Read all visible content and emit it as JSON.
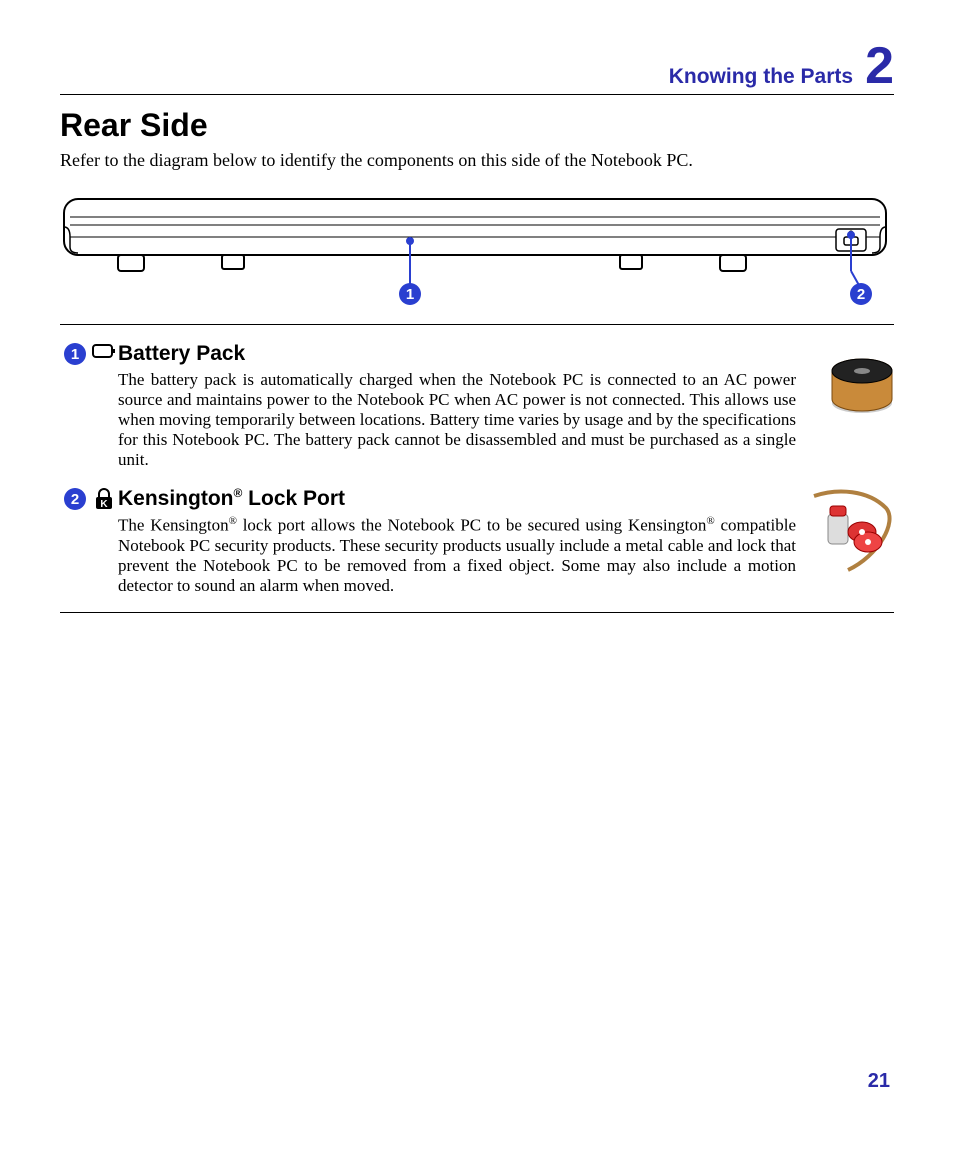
{
  "header": {
    "title": "Knowing the Parts",
    "chapter_number": "2"
  },
  "section": {
    "title": "Rear Side",
    "intro": "Refer to the diagram below to identify the components on this side of the Notebook PC."
  },
  "callouts": {
    "c1": "1",
    "c2": "2"
  },
  "items": [
    {
      "badge": "1",
      "heading_pre": "Battery Pack",
      "heading_sup": "",
      "heading_post": "",
      "text_parts": [
        "The battery pack is automatically charged when the Notebook PC is connected to an AC power source and maintains power to the Notebook PC when AC power is not connected. This allows use when moving temporarily between locations. Battery time varies by usage and by the specifications for this Notebook PC. The battery pack cannot be disassembled and must be purchased as a single unit."
      ]
    },
    {
      "badge": "2",
      "heading_pre": "Kensington",
      "heading_sup": "®",
      "heading_post": " Lock Port",
      "text_parts": [
        "The Kensington",
        "®",
        " lock port allows the Notebook PC to be secured using Kensington",
        "®",
        " compatible Notebook PC security products. These security products usually include a metal cable and lock that prevent the Notebook PC to be removed from a fixed object. Some may also include a motion detector to sound an alarm when moved."
      ]
    }
  ],
  "page_number": "21"
}
